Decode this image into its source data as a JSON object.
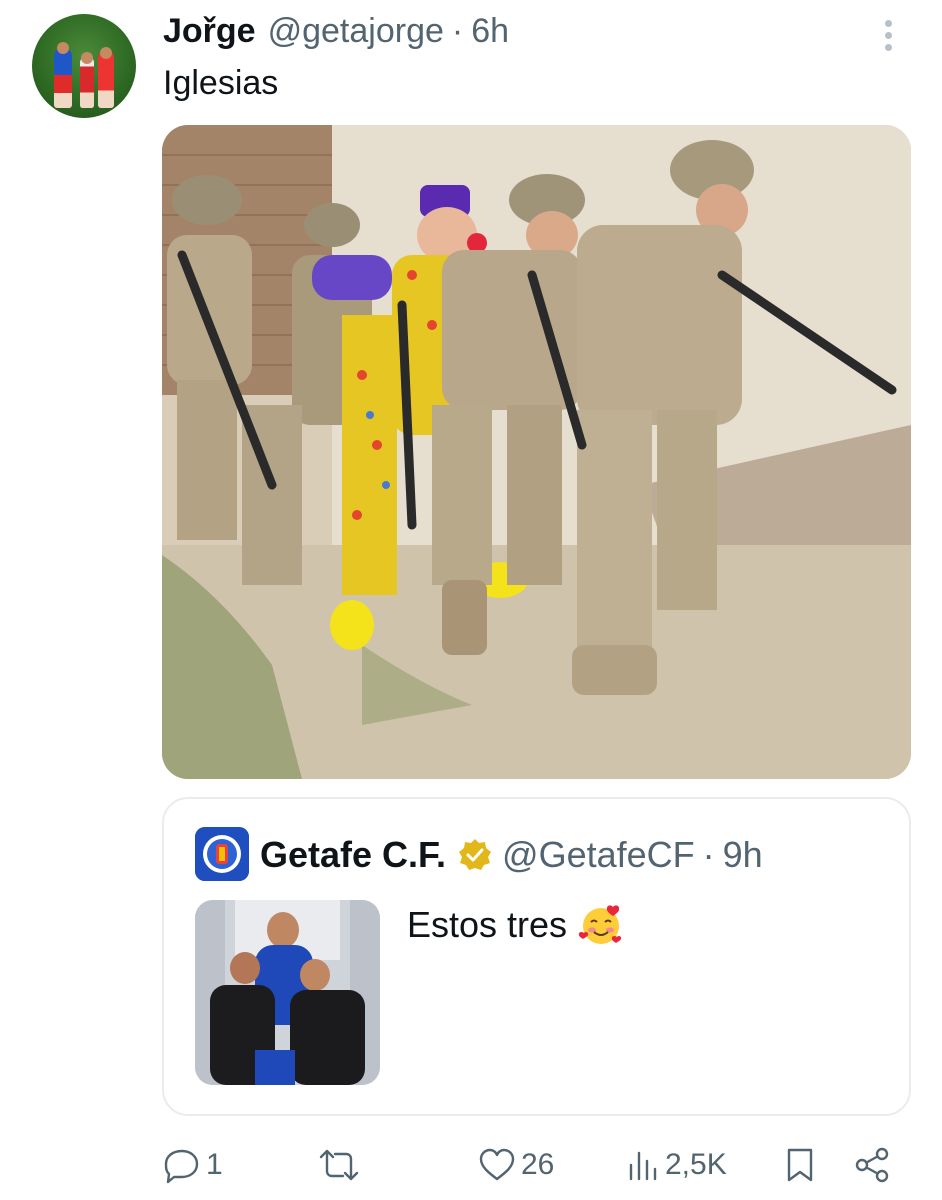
{
  "tweet": {
    "author_name": "Jořge",
    "handle": "@getajorge",
    "separator": "·",
    "time": "6h",
    "text": "Iglesias",
    "icons": {
      "more": "more-vertical-icon"
    }
  },
  "quoted_tweet": {
    "author_name": "Getafe C.F.",
    "verified_badge": "gold-verified-badge-icon",
    "handle": "@GetafeCF",
    "separator": "·",
    "time": "9h",
    "text": "Estos tres",
    "emoji": "smiling-face-with-hearts-emoji"
  },
  "actions": {
    "reply_count": "1",
    "retweet_count": "",
    "like_count": "26",
    "views_count": "2,5K",
    "icons": [
      "reply-icon",
      "retweet-icon",
      "like-icon",
      "views-icon",
      "bookmark-icon",
      "share-icon"
    ]
  },
  "colors": {
    "text_primary": "#0f1419",
    "text_secondary": "#536471",
    "border": "#e9ecef",
    "verified_gold": "#e2b719"
  }
}
